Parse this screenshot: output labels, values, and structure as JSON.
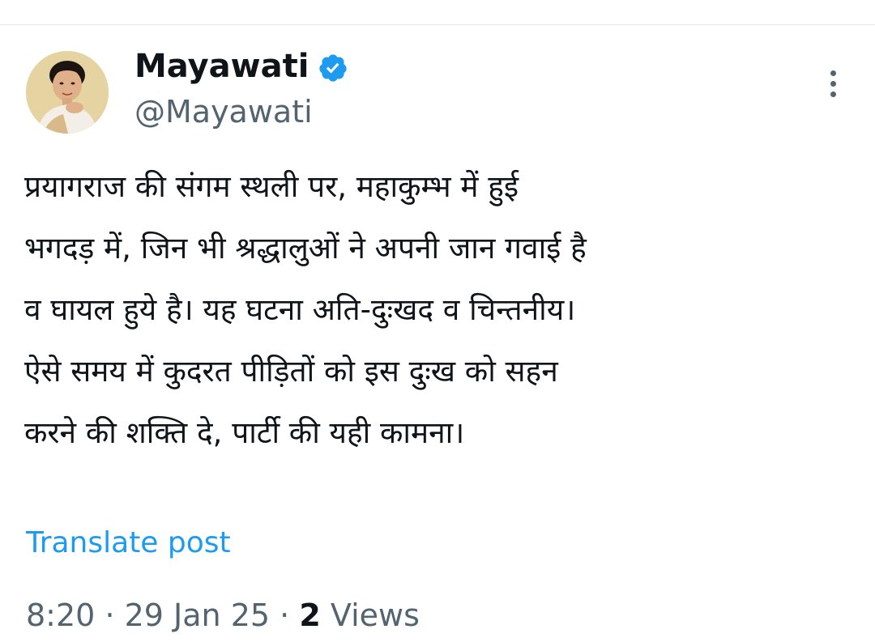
{
  "post": {
    "author": {
      "name": "Mayawati",
      "handle": "@Mayawati",
      "verified": true
    },
    "text_lines": [
      "प्रयागराज की संगम स्थली पर, महाकुम्भ में हुई",
      "भगदड़ में, जिन भी श्रद्धालुओं ने अपनी जान गवाई है",
      "व घायल हुये है। यह घटना अति-दुःखद व चिन्तनीय।",
      "ऐसे समय में कुदरत पीड़ितों को इस दुःख को सहन",
      "करने की शक्ति दे, पार्टी की यही कामना।"
    ],
    "translate_label": "Translate post",
    "time": "8:20",
    "date": "29 Jan 25",
    "separator": "·",
    "views_count": "2",
    "views_label": "Views"
  },
  "colors": {
    "text_primary": "#0f1419",
    "text_secondary": "#536471",
    "link": "#1d9bf0",
    "verified_badge": "#1d9bf0",
    "divider": "#e7e9ea"
  },
  "icons": {
    "verified": "verified-badge-icon",
    "more": "more-vertical-icon"
  }
}
